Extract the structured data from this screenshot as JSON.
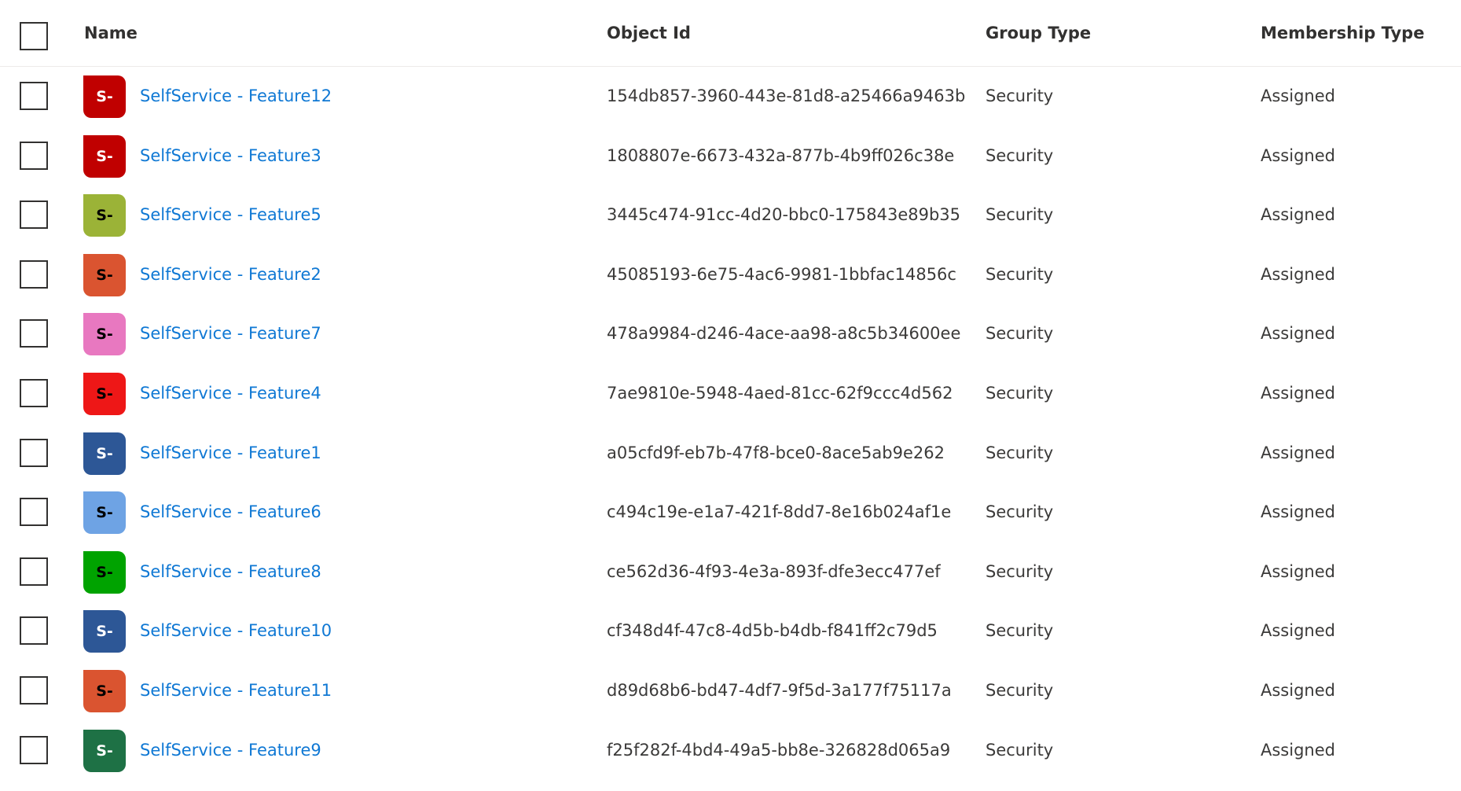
{
  "columns": {
    "select_all_label": "",
    "name": "Name",
    "object_id": "Object Id",
    "group_type": "Group Type",
    "membership_type": "Membership Type"
  },
  "rows": [
    {
      "initials": "S-",
      "name": "SelfService - Feature12",
      "object_id": "154db857-3960-443e-81d8-a25466a9463b",
      "group_type": "Security",
      "membership_type": "Assigned",
      "icon_color": "#c00000",
      "icon_text_color": "#ffffff"
    },
    {
      "initials": "S-",
      "name": "SelfService - Feature3",
      "object_id": "1808807e-6673-432a-877b-4b9ff026c38e",
      "group_type": "Security",
      "membership_type": "Assigned",
      "icon_color": "#c00000",
      "icon_text_color": "#ffffff"
    },
    {
      "initials": "S-",
      "name": "SelfService - Feature5",
      "object_id": "3445c474-91cc-4d20-bbc0-175843e89b35",
      "group_type": "Security",
      "membership_type": "Assigned",
      "icon_color": "#9bb337",
      "icon_text_color": "#000000"
    },
    {
      "initials": "S-",
      "name": "SelfService - Feature2",
      "object_id": "45085193-6e75-4ac6-9981-1bbfac14856c",
      "group_type": "Security",
      "membership_type": "Assigned",
      "icon_color": "#da5430",
      "icon_text_color": "#000000"
    },
    {
      "initials": "S-",
      "name": "SelfService - Feature7",
      "object_id": "478a9984-d246-4ace-aa98-a8c5b34600ee",
      "group_type": "Security",
      "membership_type": "Assigned",
      "icon_color": "#e878c0",
      "icon_text_color": "#000000"
    },
    {
      "initials": "S-",
      "name": "SelfService - Feature4",
      "object_id": "7ae9810e-5948-4aed-81cc-62f9ccc4d562",
      "group_type": "Security",
      "membership_type": "Assigned",
      "icon_color": "#ee1717",
      "icon_text_color": "#000000"
    },
    {
      "initials": "S-",
      "name": "SelfService - Feature1",
      "object_id": "a05cfd9f-eb7b-47f8-bce0-8ace5ab9e262",
      "group_type": "Security",
      "membership_type": "Assigned",
      "icon_color": "#2d5796",
      "icon_text_color": "#ffffff"
    },
    {
      "initials": "S-",
      "name": "SelfService - Feature6",
      "object_id": "c494c19e-e1a7-421f-8dd7-8e16b024af1e",
      "group_type": "Security",
      "membership_type": "Assigned",
      "icon_color": "#6ea3e4",
      "icon_text_color": "#000000"
    },
    {
      "initials": "S-",
      "name": "SelfService - Feature8",
      "object_id": "ce562d36-4f93-4e3a-893f-dfe3ecc477ef",
      "group_type": "Security",
      "membership_type": "Assigned",
      "icon_color": "#00a300",
      "icon_text_color": "#000000"
    },
    {
      "initials": "S-",
      "name": "SelfService - Feature10",
      "object_id": "cf348d4f-47c8-4d5b-b4db-f841ff2c79d5",
      "group_type": "Security",
      "membership_type": "Assigned",
      "icon_color": "#2d5796",
      "icon_text_color": "#ffffff"
    },
    {
      "initials": "S-",
      "name": "SelfService - Feature11",
      "object_id": "d89d68b6-bd47-4df7-9f5d-3a177f75117a",
      "group_type": "Security",
      "membership_type": "Assigned",
      "icon_color": "#da5430",
      "icon_text_color": "#000000"
    },
    {
      "initials": "S-",
      "name": "SelfService - Feature9",
      "object_id": "f25f282f-4bd4-49a5-bb8e-326828d065a9",
      "group_type": "Security",
      "membership_type": "Assigned",
      "icon_color": "#1e7145",
      "icon_text_color": "#ffffff"
    }
  ]
}
